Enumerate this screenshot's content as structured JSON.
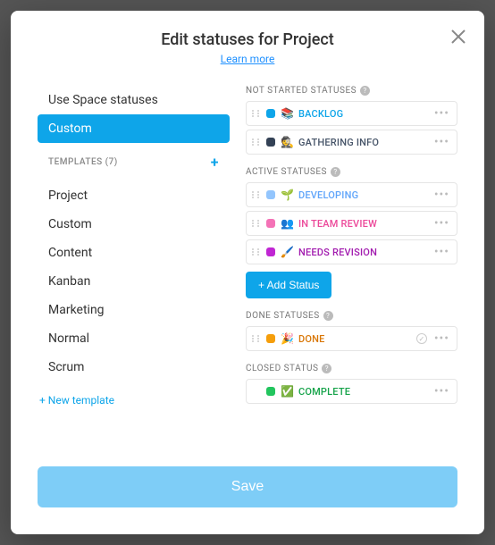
{
  "header": {
    "title": "Edit statuses for Project",
    "learn_more": "Learn more"
  },
  "sidebar": {
    "use_space": "Use Space statuses",
    "custom": "Custom",
    "templates_heading": "TEMPLATES (7)",
    "templates": [
      "Project",
      "Custom",
      "Content",
      "Kanban",
      "Marketing",
      "Normal",
      "Scrum"
    ],
    "new_template": "+ New template"
  },
  "sections": {
    "not_started": {
      "label": "NOT STARTED STATUSES",
      "items": [
        {
          "emoji": "📚",
          "name": "BACKLOG",
          "color": "#0ea5e9",
          "text": "#0ea5e9"
        },
        {
          "emoji": "🕵️",
          "name": "GATHERING INFO",
          "color": "#334155",
          "text": "#475569"
        }
      ]
    },
    "active": {
      "label": "ACTIVE STATUSES",
      "add": "+ Add Status",
      "items": [
        {
          "emoji": "🌱",
          "name": "DEVELOPING",
          "color": "#93c5fd",
          "text": "#60a5fa"
        },
        {
          "emoji": "👥",
          "name": "IN TEAM REVIEW",
          "color": "#f472b6",
          "text": "#ec4899"
        },
        {
          "emoji": "🖌️",
          "name": "NEEDS REVISION",
          "color": "#c026d3",
          "text": "#a21caf"
        }
      ]
    },
    "done": {
      "label": "DONE STATUSES",
      "items": [
        {
          "emoji": "🎉",
          "name": "DONE",
          "color": "#f59e0b",
          "text": "#d97706"
        }
      ]
    },
    "closed": {
      "label": "CLOSED STATUS",
      "items": [
        {
          "emoji": "✅",
          "name": "COMPLETE",
          "color": "#22c55e",
          "text": "#16a34a"
        }
      ]
    }
  },
  "footer": {
    "save": "Save"
  }
}
